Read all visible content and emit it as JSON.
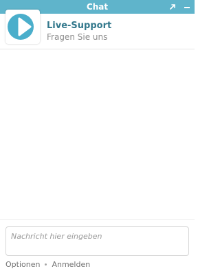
{
  "window": {
    "title": "Chat",
    "titlebar_color": "#5fb4cb"
  },
  "header": {
    "agent_name": "Live-Support",
    "agent_subtitle": "Fragen Sie uns",
    "avatar_icon": "play-logo-icon",
    "accent_color": "#4aaecb"
  },
  "controls": {
    "popout_icon": "popout-arrow-icon",
    "minimize_icon": "minimize-icon"
  },
  "composer": {
    "placeholder": "Nachricht hier eingeben",
    "value": ""
  },
  "footer": {
    "options_label": "Optionen",
    "login_label": "Anmelden"
  }
}
